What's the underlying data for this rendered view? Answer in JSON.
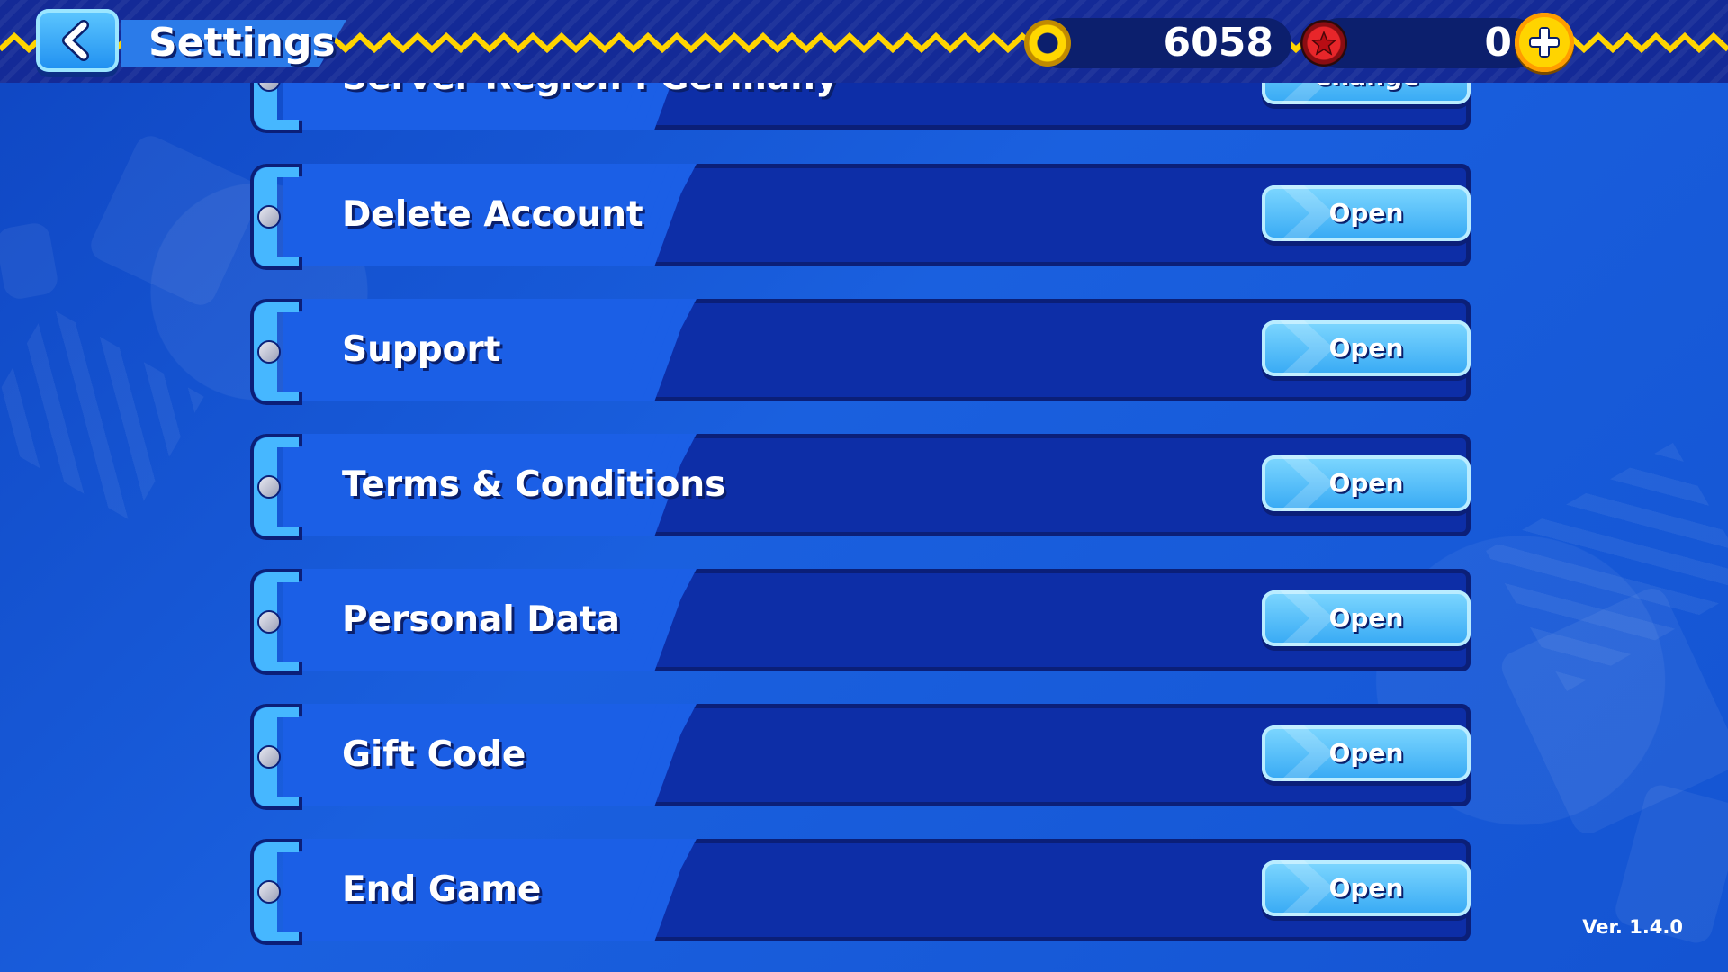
{
  "header": {
    "title": "Settings",
    "back_icon": "chevron-left-icon",
    "coins": "6058",
    "coin_icon": "gold-ring-icon",
    "red_star_rings": "0",
    "red_star_icon": "red-star-ring-icon",
    "add_icon": "plus-icon"
  },
  "settings_items": [
    {
      "label": "Server Region : Germany",
      "button": "Change"
    },
    {
      "label": "Delete Account",
      "button": "Open"
    },
    {
      "label": "Support",
      "button": "Open"
    },
    {
      "label": "Terms & Conditions",
      "button": "Open"
    },
    {
      "label": "Personal Data",
      "button": "Open"
    },
    {
      "label": "Gift Code",
      "button": "Open"
    },
    {
      "label": "End Game",
      "button": "Open"
    }
  ],
  "footer": {
    "version": "Ver.  1.4.0"
  },
  "colors": {
    "background": "#1553cf",
    "topbar": "#142a97",
    "zigzag": "#ffd400",
    "row_fill": "#1b5fe6",
    "row_dark": "#0d2ea7",
    "button": "#35a8f4"
  }
}
